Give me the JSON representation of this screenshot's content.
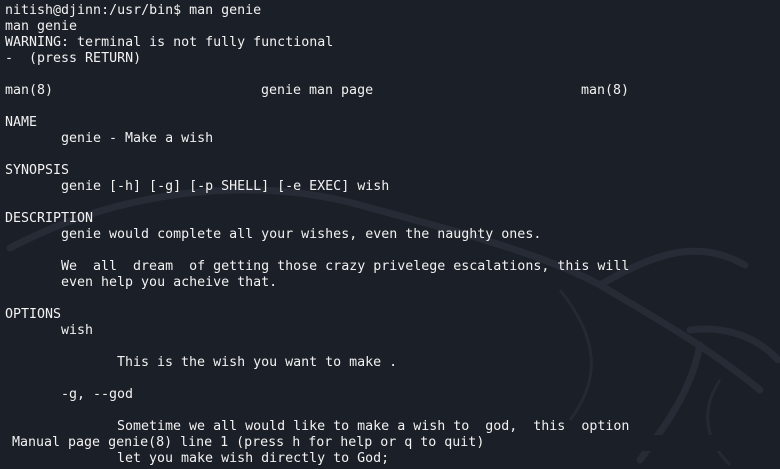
{
  "terminal": {
    "prompt": "nitish@djinn:/usr/bin$ man genie",
    "echo": "man genie",
    "warning": "WARNING: terminal is not fully functional",
    "press_return": "-  (press RETURN)"
  },
  "manpage": {
    "header_left": "man(8)",
    "header_center": "genie man page",
    "header_right": "man(8)",
    "name_heading": "NAME",
    "name_text": "genie - Make a wish",
    "synopsis_heading": "SYNOPSIS",
    "synopsis_text": "genie [-h] [-g] [-p SHELL] [-e EXEC] wish",
    "description_heading": "DESCRIPTION",
    "description_line1": "genie would complete all your wishes, even the naughty ones.",
    "description_line2": "We  all  dream  of getting those crazy privelege escalations, this will",
    "description_line3": "even help you acheive that.",
    "options_heading": "OPTIONS",
    "option_wish": "wish",
    "option_wish_desc": "This is the wish you want to make .",
    "option_god": "-g, --god",
    "option_god_desc1": "Sometime we all would like to make a wish to  god,  this  option",
    "option_god_desc2": "let you make wish directly to God;"
  },
  "pager": {
    "status": "Manual page genie(8) line 1 (press h for help or q to quit)"
  },
  "colors": {
    "background": "#1b1f27",
    "text": "#f2f2f2"
  }
}
